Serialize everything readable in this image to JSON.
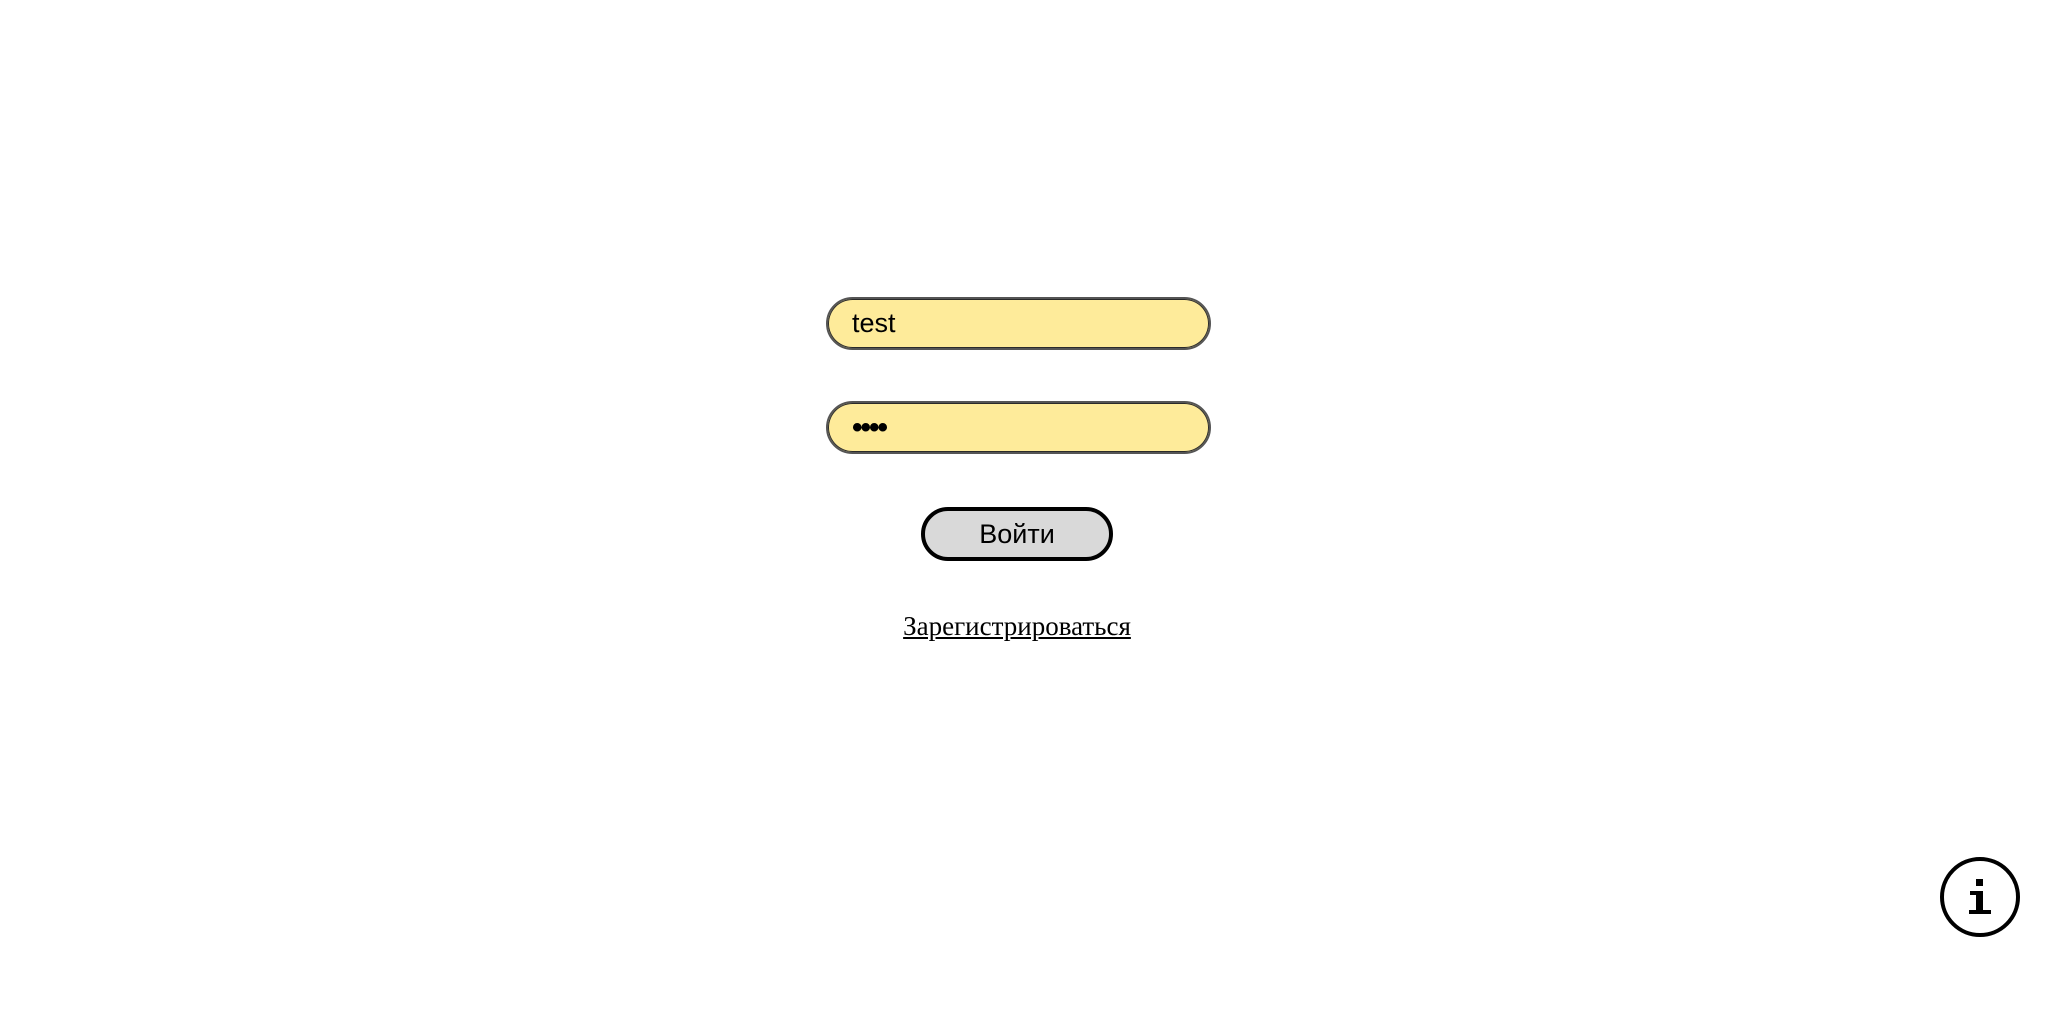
{
  "login_form": {
    "login_value": "test",
    "password_value": "••••",
    "submit_label": "Войти",
    "register_link_label": "Зарегистрироваться"
  },
  "info_button": {
    "icon": "info-icon"
  },
  "colors": {
    "field_background": "#feeb9a",
    "button_background": "#d9d9d9",
    "border": "#000000"
  }
}
